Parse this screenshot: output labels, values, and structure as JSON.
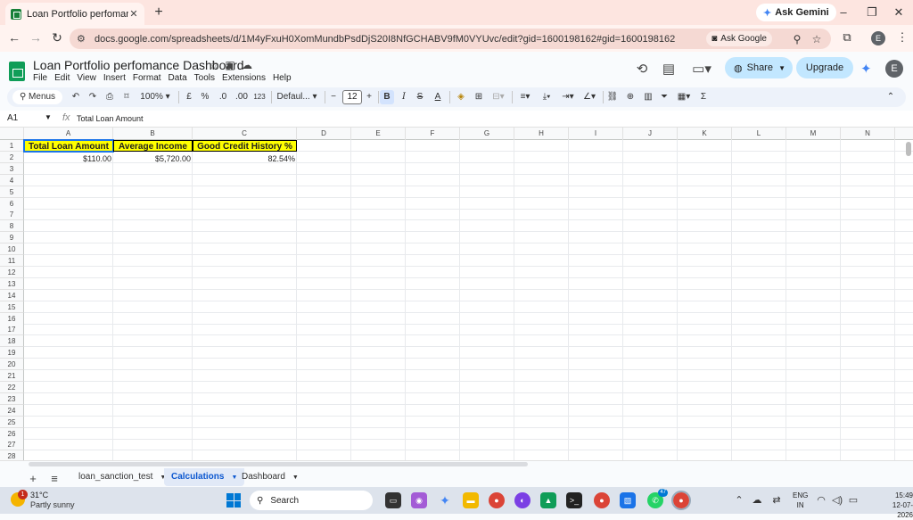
{
  "browser": {
    "tab_title": "Loan Portfolio perfomance Das",
    "tab_close": "✕",
    "new_tab": "+",
    "ask_gemini": "Ask Gemini",
    "url": "docs.google.com/spreadsheets/d/1M4yFxuH0XomMundbPsdDjS20I8NfGCHABV9fM0VYUvc/edit?gid=1600198162#gid=1600198162",
    "ask_google": "Ask Google",
    "profile_initial": "E",
    "window_controls": [
      "–",
      "❐",
      "✕"
    ]
  },
  "sheets_header": {
    "doc_title": "Loan Portfolio perfomance Dashboard",
    "menu": [
      "File",
      "Edit",
      "View",
      "Insert",
      "Format",
      "Data",
      "Tools",
      "Extensions",
      "Help"
    ],
    "share_label": "Share",
    "upgrade_label": "Upgrade",
    "account_initial": "E"
  },
  "toolbar": {
    "menus_label": "Menus",
    "zoom": "100%",
    "currency": "£",
    "percent": "%",
    "dec_decrease": ".0",
    "dec_increase": ".00",
    "format_123": "123",
    "font": "Defaul...",
    "font_size": "12",
    "bold": "B",
    "italic": "I",
    "strike": "S",
    "text_color": "A",
    "sigma": "Σ"
  },
  "formula_bar": {
    "cell_ref": "A1",
    "fx": "fx",
    "value": "Total Loan Amount"
  },
  "grid": {
    "columns": [
      "A",
      "B",
      "C",
      "D",
      "E",
      "F",
      "G",
      "H",
      "I",
      "J",
      "K",
      "L",
      "M",
      "N"
    ],
    "rows": [
      "1",
      "2",
      "3",
      "4",
      "5",
      "6",
      "7",
      "8",
      "9",
      "10",
      "11",
      "12",
      "13",
      "14",
      "15",
      "16",
      "17",
      "18",
      "19",
      "20",
      "21",
      "22",
      "23",
      "24",
      "25",
      "26",
      "27",
      "28"
    ],
    "headers": {
      "a1": "Total Loan Amount",
      "b1": "Average Income",
      "c1": "Good Credit History %"
    },
    "values": {
      "a2": "$110.00",
      "b2": "$5,720.00",
      "c2": "82.54%"
    },
    "header_fill": "#ffff00"
  },
  "sheet_tabs": {
    "add": "+",
    "list": "≡",
    "tabs": [
      "loan_sanction_test",
      "Calculations",
      "Dashboard"
    ],
    "active": "Calculations"
  },
  "taskbar": {
    "weather_temp": "31°C",
    "weather_desc": "Partly sunny",
    "weather_badge": "1",
    "search_placeholder": "Search",
    "whatsapp_badge": "47",
    "lang_line1": "ENG",
    "lang_line2": "IN",
    "time": "15:49",
    "date": "12-07-2026"
  }
}
